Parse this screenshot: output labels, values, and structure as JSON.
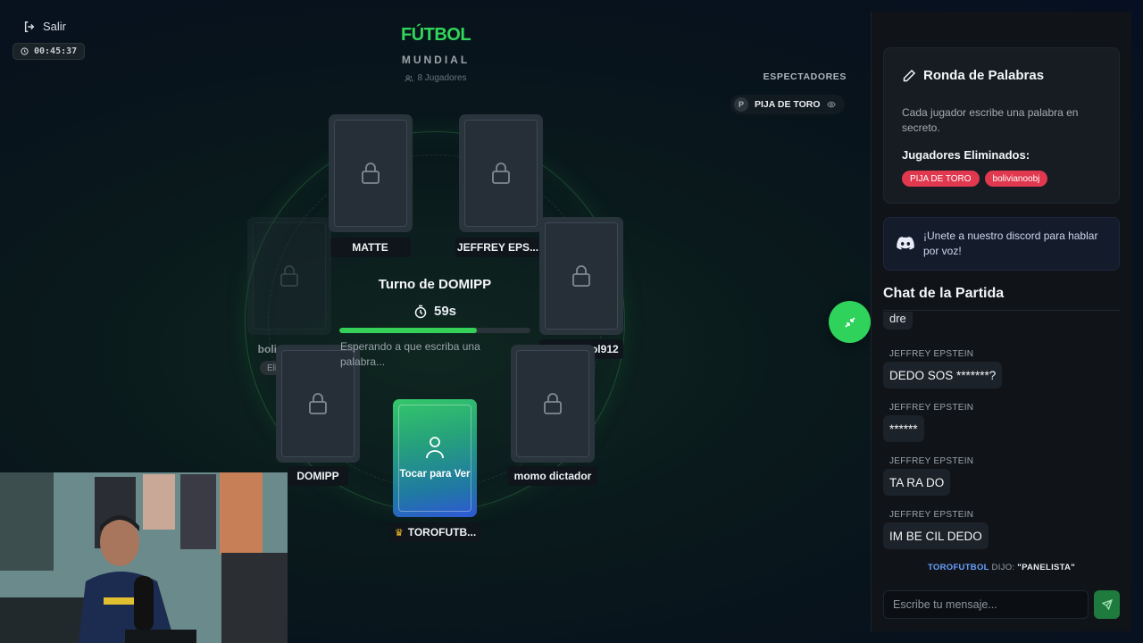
{
  "header": {
    "exit_label": "Salir",
    "elapsed": "00:45:37",
    "title": "FÚTBOL",
    "subtitle": "MUNDIAL",
    "players_count": "8 Jugadores"
  },
  "spectators": {
    "title": "ESPECTADORES",
    "items": [
      {
        "initial": "P",
        "name": "PIJA DE TORO"
      }
    ]
  },
  "table": {
    "players": [
      {
        "name": "MATTE"
      },
      {
        "name": "JEFFREY EPS..."
      },
      {
        "name": "bolivianoobj",
        "status": "Eliminado"
      },
      {
        "name": "Dedofutbol912"
      },
      {
        "name": "DOMIPP"
      },
      {
        "name": "momo dictador"
      }
    ],
    "my_card": {
      "label": "Tocar para Ver",
      "name": "TOROFUTB..."
    },
    "turn_title": "Turno de DOMIPP",
    "turn_seconds": "59s",
    "turn_progress": 0.72,
    "waiting": "Esperando a que escriba una palabra..."
  },
  "round": {
    "title": "Ronda de Palabras",
    "description": "Cada jugador escribe una palabra en secreto.",
    "eliminated_title": "Jugadores Eliminados:",
    "eliminated": [
      "PIJA DE TORO",
      "bolivianoobj"
    ]
  },
  "discord": {
    "text": "¡Unete a nuestro discord para hablar por voz!"
  },
  "chat": {
    "title": "Chat de la Partida",
    "cut_message": "dre",
    "messages": [
      {
        "user": "JEFFREY EPSTEIN",
        "text": "DEDO SOS *******?"
      },
      {
        "user": "JEFFREY EPSTEIN",
        "text": "******"
      },
      {
        "user": "JEFFREY EPSTEIN",
        "text": "TA RA DO"
      },
      {
        "user": "JEFFREY EPSTEIN",
        "text": "IM BE CIL DEDO"
      }
    ],
    "system": {
      "who": "TOROFUTBOL",
      "said": "DIJO:",
      "word": "\"PANELISTA\""
    },
    "input_placeholder": "Escribe tu mensaje..."
  },
  "colors": {
    "accent": "#32d65a",
    "danger": "#e0384f",
    "panel": "#101419"
  }
}
